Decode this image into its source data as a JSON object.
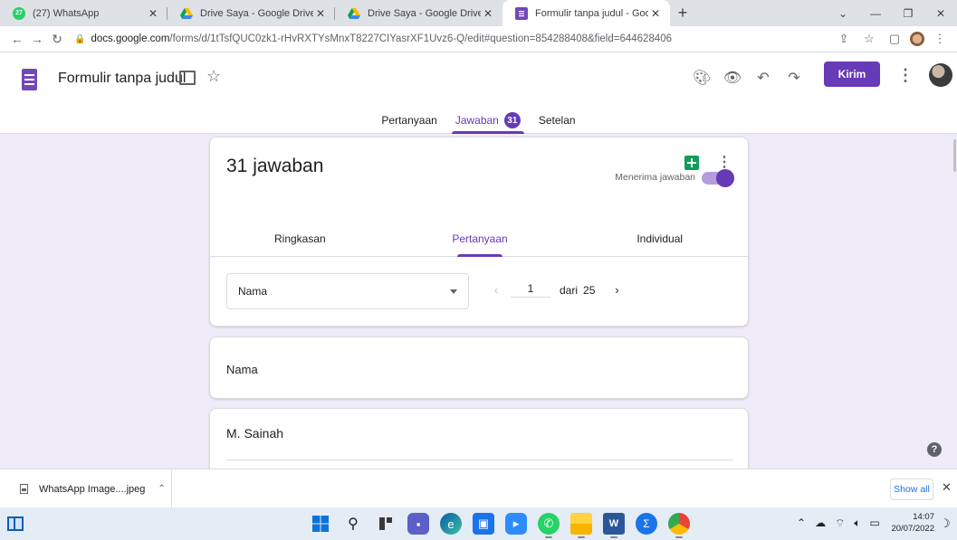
{
  "browser": {
    "tabs": [
      {
        "title": "(27) WhatsApp",
        "favicon": "whatsapp-icon",
        "badge": "27",
        "active": false
      },
      {
        "title": "Drive Saya - Google Drive",
        "favicon": "google-drive-icon",
        "active": false
      },
      {
        "title": "Drive Saya - Google Drive",
        "favicon": "google-drive-icon",
        "active": false
      },
      {
        "title": "Formulir tanpa judul - Google Fo",
        "favicon": "google-forms-icon",
        "active": true
      }
    ],
    "url_host": "docs.google.com",
    "url_path": "/forms/d/1tTsfQUC0zk1-rHvRXTYsMnxT8227CIYasrXF1Uvz6-Q/edit#question=854288408&field=644628406"
  },
  "form": {
    "title": "Formulir tanpa judul",
    "send_label": "Kirim",
    "nav_tabs": [
      {
        "label": "Pertanyaan",
        "active": false
      },
      {
        "label": "Jawaban",
        "active": true,
        "badge": "31"
      },
      {
        "label": "Setelan",
        "active": false
      }
    ]
  },
  "responses": {
    "title": "31 jawaban",
    "accepting_label": "Menerima jawaban",
    "accepting": true,
    "sub_tabs": [
      {
        "label": "Ringkasan",
        "active": false
      },
      {
        "label": "Pertanyaan",
        "active": true
      },
      {
        "label": "Individual",
        "active": false
      }
    ],
    "question_select_value": "Nama",
    "page_current": "1",
    "page_of_label": "dari",
    "page_total": "25"
  },
  "question_card": {
    "text": "Nama"
  },
  "answer_card": {
    "text": "M. Sainah"
  },
  "download_shelf": {
    "file_name": "WhatsApp Image....jpeg",
    "show_all_label": "Show all"
  },
  "taskbar": {
    "time": "14:07",
    "date": "20/07/2022"
  },
  "colors": {
    "accent": "#673ab7",
    "page_bg": "#f0ebf8",
    "sheets_green": "#0f9d58"
  }
}
